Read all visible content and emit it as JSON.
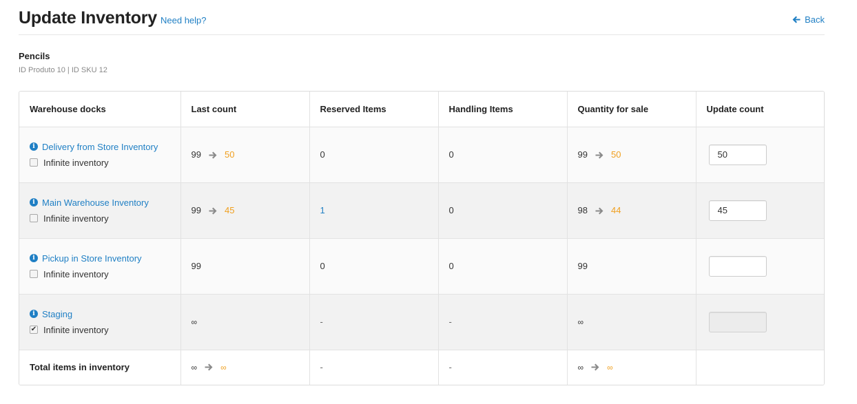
{
  "header": {
    "title": "Update Inventory",
    "help_label": "Need help?",
    "back_label": "Back"
  },
  "product": {
    "name": "Pencils",
    "ids": "ID Produto 10 | ID SKU 12"
  },
  "table": {
    "columns": [
      "Warehouse docks",
      "Last count",
      "Reserved Items",
      "Handling Items",
      "Quantity for sale",
      "Update count"
    ],
    "infinite_label": "Infinite inventory",
    "rows": [
      {
        "dock": "Delivery from Store Inventory",
        "infinite": false,
        "last_count": "99",
        "last_count_new": "50",
        "reserved": "0",
        "handling": "0",
        "quantity": "99",
        "quantity_new": "50",
        "update_value": "50"
      },
      {
        "dock": "Main Warehouse Inventory",
        "infinite": false,
        "last_count": "99",
        "last_count_new": "45",
        "reserved": "1",
        "handling": "0",
        "quantity": "98",
        "quantity_new": "44",
        "update_value": "45"
      },
      {
        "dock": "Pickup in Store Inventory",
        "infinite": false,
        "last_count": "99",
        "reserved": "0",
        "handling": "0",
        "quantity": "99",
        "update_value": ""
      },
      {
        "dock": "Staging",
        "infinite": true,
        "last_count": "∞",
        "reserved": "-",
        "handling": "-",
        "quantity": "∞",
        "update_value": ""
      }
    ],
    "total": {
      "label": "Total items in inventory",
      "last_count": "∞",
      "last_count_new": "∞",
      "reserved": "-",
      "handling": "-",
      "quantity": "∞",
      "quantity_new": "∞"
    }
  },
  "colors": {
    "link": "#1f7fc4",
    "new_value": "#f0a020",
    "arrow": "#8a8a8a"
  },
  "icons": {
    "info": "info-circle-icon",
    "arrow": "arrow-right-icon",
    "back": "arrow-left-icon",
    "check": "checkmark-icon"
  }
}
